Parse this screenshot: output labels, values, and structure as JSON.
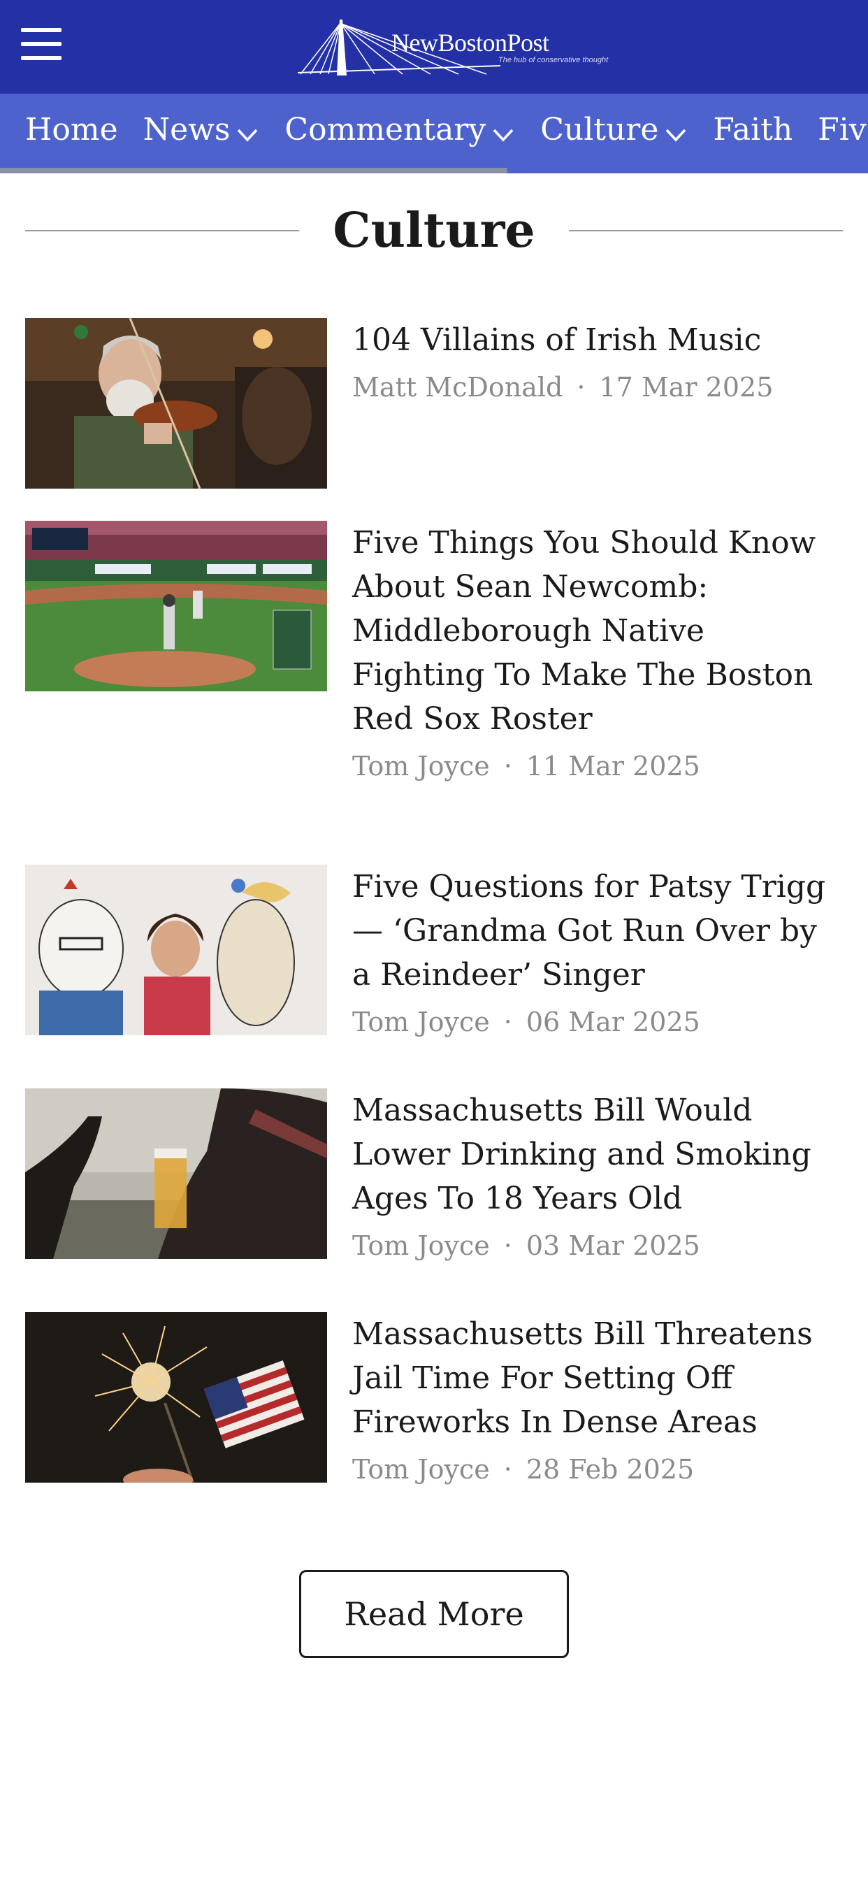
{
  "header": {
    "logo_text": "NewBostonPost",
    "logo_tagline": "The hub of conservative thought",
    "menu_icon": "hamburger-menu-icon",
    "brand_color": "#2430a6",
    "nav_color": "#4d62cc"
  },
  "nav": {
    "items": [
      {
        "label": "Home",
        "has_dropdown": false
      },
      {
        "label": "News",
        "has_dropdown": true
      },
      {
        "label": "Commentary",
        "has_dropdown": true
      },
      {
        "label": "Culture",
        "has_dropdown": true
      },
      {
        "label": "Faith",
        "has_dropdown": false
      },
      {
        "label": "Fiv",
        "has_dropdown": false
      }
    ]
  },
  "section": {
    "title": "Culture"
  },
  "articles": [
    {
      "title": "104 Villains of Irish Music",
      "author": "Matt McDonald",
      "date": "17 Mar 2025"
    },
    {
      "title": "Five Things You Should Know About Sean Newcomb: Middleborough Native Fighting To Make The Boston Red Sox Roster",
      "author": "Tom Joyce",
      "date": "11 Mar 2025"
    },
    {
      "title": "Five Questions for Patsy Trigg — ‘Grandma Got Run Over by a Reindeer’ Singer",
      "author": "Tom Joyce",
      "date": "06 Mar 2025"
    },
    {
      "title": "Massachusetts Bill Would Lower Drinking and Smoking Ages To 18 Years Old",
      "author": "Tom Joyce",
      "date": "03 Mar 2025"
    },
    {
      "title": "Massachusetts Bill Threatens Jail Time For Setting Off Fireworks In Dense Areas",
      "author": "Tom Joyce",
      "date": "28 Feb 2025"
    }
  ],
  "meta_separator": "·",
  "read_more_label": "Read More"
}
